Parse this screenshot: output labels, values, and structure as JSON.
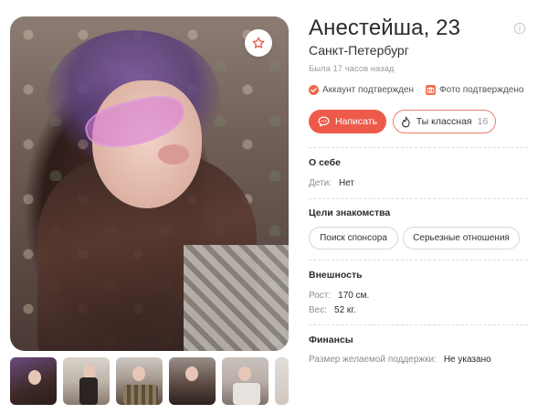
{
  "profile": {
    "name_age": "Анестейша, 23",
    "city": "Санкт-Петербург",
    "last_seen": "Была 17 часов назад",
    "account_verified": "Аккаунт подтвержден",
    "photo_verified": "Фото подтверждено"
  },
  "actions": {
    "write_label": "Написать",
    "like_label": "Ты классная",
    "like_count": "16"
  },
  "about": {
    "title": "О себе",
    "children_label": "Дети:",
    "children_value": "Нет"
  },
  "goals": {
    "title": "Цели знакомства",
    "chips": [
      "Поиск спонсора",
      "Серьезные отношения"
    ]
  },
  "appearance": {
    "title": "Внешность",
    "height_label": "Рост:",
    "height_value": "170 см.",
    "weight_label": "Вес:",
    "weight_value": "52 кг."
  },
  "finance": {
    "title": "Финансы",
    "support_label": "Размер желаемой поддержки:",
    "support_value": "Не указано"
  },
  "icons": {
    "favorite": "star-icon",
    "info": "info-icon",
    "verified": "check-circle-icon",
    "photo": "camera-icon",
    "message": "chat-bubble-icon",
    "like": "flame-icon"
  },
  "colors": {
    "accent": "#ee5a4a",
    "accent_border": "#ee7a6c",
    "muted": "#9a9a9a"
  }
}
